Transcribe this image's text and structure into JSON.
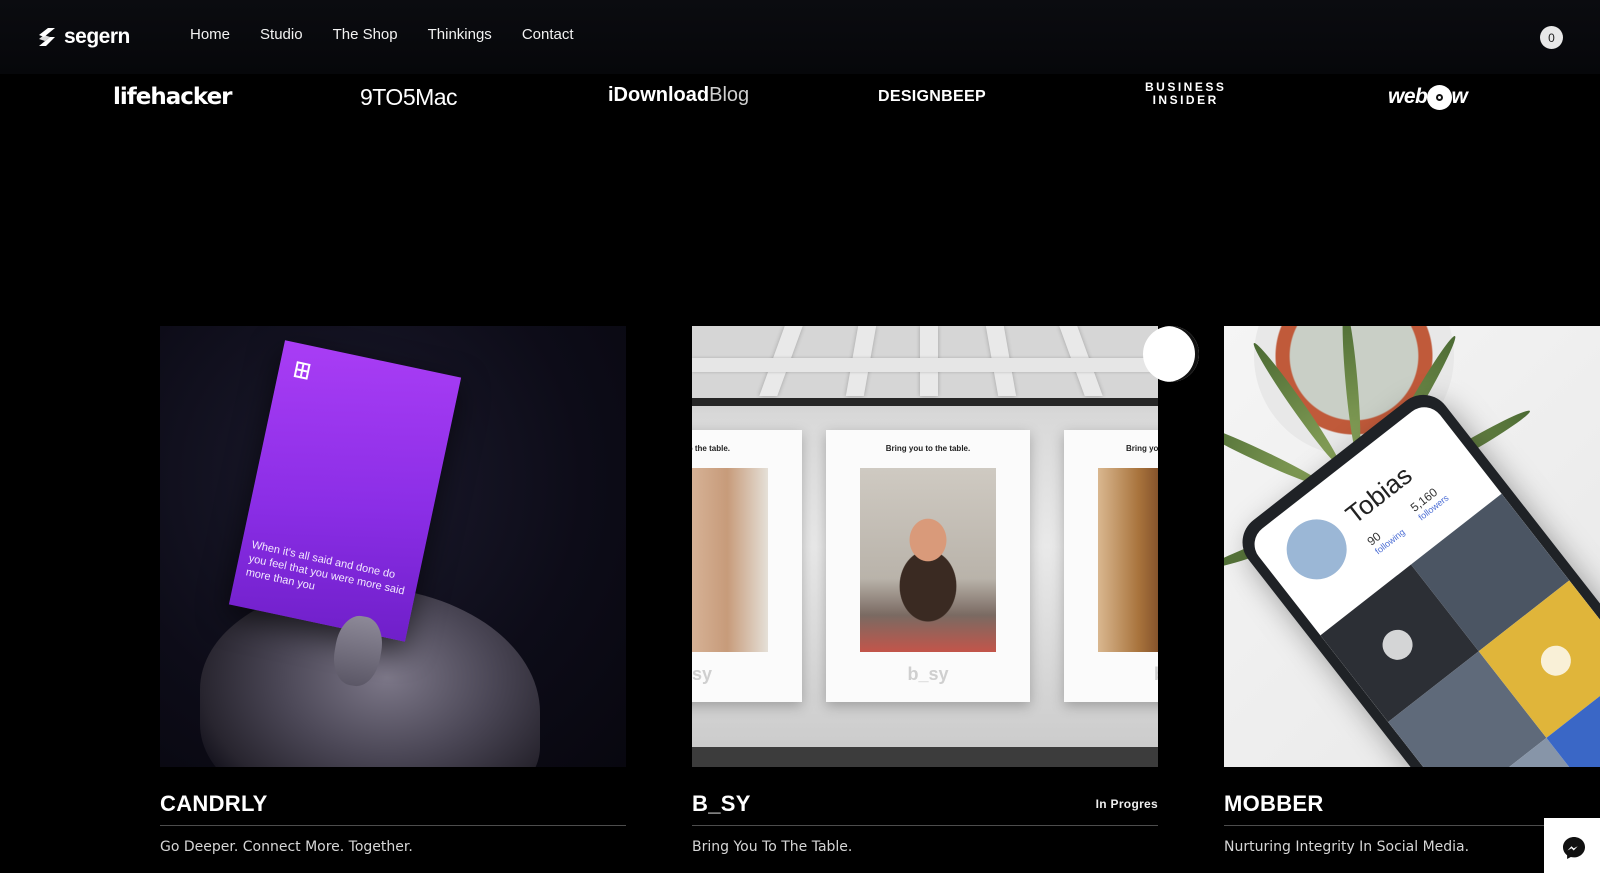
{
  "header": {
    "logo_text": "segern",
    "nav": [
      {
        "label": "Home"
      },
      {
        "label": "Studio"
      },
      {
        "label": "The Shop"
      },
      {
        "label": "Thinkings"
      },
      {
        "label": "Contact"
      }
    ],
    "cart_count": "0"
  },
  "press": {
    "lifehacker": "lifehacker",
    "ninetofive": "9TO5Mac",
    "idownload_bold": "iDownload",
    "idownload_light": "Blog",
    "designbeep": "DESIGNBEEP",
    "business_line1": "BUSINESS",
    "business_line2": "INSIDER",
    "webflow": "webflow"
  },
  "projects": [
    {
      "title": "CANDRLY",
      "tagline": "Go Deeper. Connect More. Together.",
      "card_text": "When it's all said and done do you feel that you were more said more than you"
    },
    {
      "title": "B_SY",
      "status": "In Progres",
      "tagline": "Bring You To The Table.",
      "poster_caption": "Bring you to the table.",
      "poster_caption_left": "o the table.",
      "poster_caption_right": "Bring yo",
      "poster_brand": "b_sy",
      "poster_brand_left": "sy",
      "poster_brand_right": "b"
    },
    {
      "title": "MOBBER",
      "tagline": "Nurturing Integrity In Social Media.",
      "profile_name": "Tobias",
      "following": "90",
      "following_label": "following",
      "followers": "5,160",
      "followers_label": "followers"
    }
  ],
  "colors": {
    "accent_purple": "#9b35f0",
    "background": "#000000"
  },
  "icons": {
    "chat": "messenger-icon",
    "logo": "segern-logo-icon"
  }
}
